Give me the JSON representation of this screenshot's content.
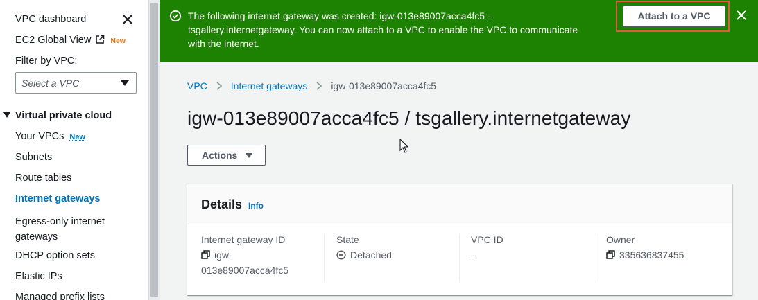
{
  "sidebar": {
    "vpc_dashboard": "VPC dashboard",
    "ec2_global_view": "EC2 Global View",
    "ec2_badge": "New",
    "filter_label": "Filter by VPC:",
    "filter_placeholder": "Select a VPC",
    "section_title": "Virtual private cloud",
    "items": [
      {
        "label": "Your VPCs",
        "badge": "New"
      },
      {
        "label": "Subnets"
      },
      {
        "label": "Route tables"
      },
      {
        "label": "Internet gateways",
        "active": true
      },
      {
        "label": "Egress-only internet",
        "label2": "gateways"
      },
      {
        "label": "DHCP option sets"
      },
      {
        "label": "Elastic IPs"
      },
      {
        "label": "Managed prefix lists"
      }
    ]
  },
  "banner": {
    "line1": "The following internet gateway was created: igw-013e89007acca4fc5 -",
    "line2": "tsgallery.internetgateway. You can now attach to a VPC to enable the VPC to communicate",
    "line3": "with the internet.",
    "attach_label": "Attach to a VPC",
    "color": "#1d8102"
  },
  "breadcrumb": {
    "vpc": "VPC",
    "internet_gateways": "Internet gateways",
    "current": "igw-013e89007acca4fc5"
  },
  "page_title": "igw-013e89007acca4fc5 / tsgallery.internetgateway",
  "actions_label": "Actions",
  "details": {
    "title": "Details",
    "info": "Info",
    "gateway_id_label": "Internet gateway ID",
    "gateway_id_line1": "igw-",
    "gateway_id_line2": "013e89007acca4fc5",
    "state_label": "State",
    "state_value": "Detached",
    "vpc_id_label": "VPC ID",
    "vpc_id_value": "-",
    "owner_label": "Owner",
    "owner_value": "335636837455"
  },
  "colors": {
    "accent": "#0073bb",
    "success": "#1d8102",
    "highlight": "#e05a3e",
    "new_badge": "#ec7211"
  }
}
